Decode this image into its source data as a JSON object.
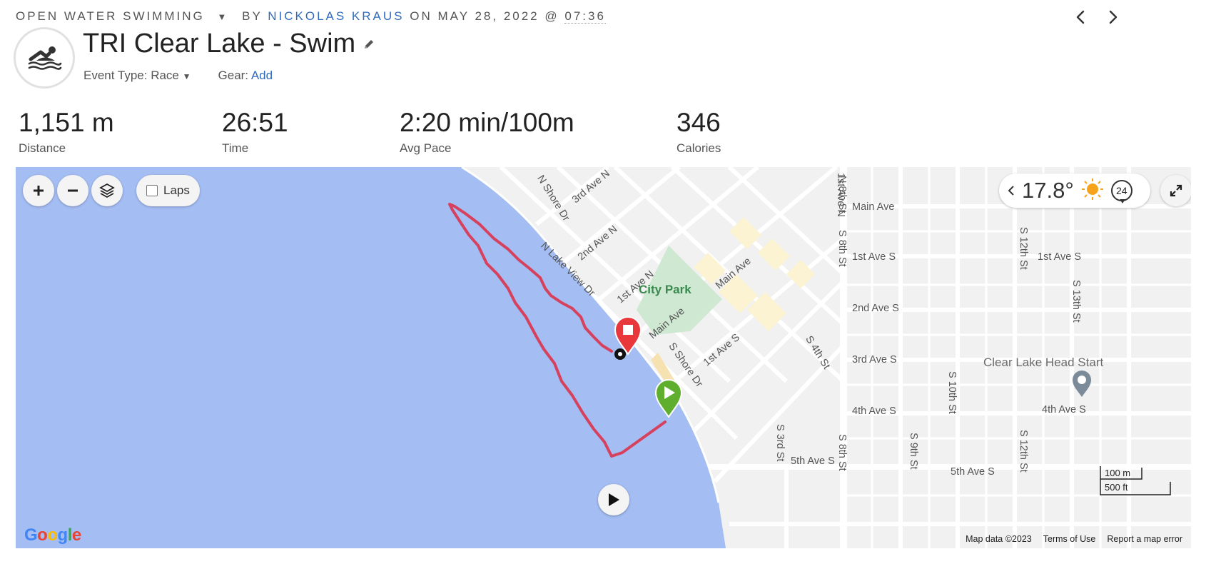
{
  "header": {
    "activity_type": "OPEN WATER SWIMMING",
    "by_text": "BY",
    "author": "NICKOLAS KRAUS",
    "on_text": "ON",
    "date": "MAY 28, 2022",
    "at_text": "@",
    "time": "07:36",
    "title": "TRI Clear Lake - Swim",
    "event_type_label": "Event Type:",
    "event_type_value": "Race",
    "gear_label": "Gear:",
    "gear_action": "Add"
  },
  "icons": {
    "activity": "swim-icon",
    "edit": "pencil-icon",
    "prev": "chevron-left-icon",
    "next": "chevron-right-icon"
  },
  "stats": [
    {
      "value": "1,151 m",
      "label": "Distance"
    },
    {
      "value": "26:51",
      "label": "Time"
    },
    {
      "value": "2:20 min/100m",
      "label": "Avg Pace"
    },
    {
      "value": "346",
      "label": "Calories"
    }
  ],
  "map": {
    "laps_label": "Laps",
    "weather_temp": "17.8°",
    "wind_speed": "24",
    "park": "City Park",
    "poi": "Clear Lake Head Start",
    "streets": {
      "n_shore_dr": "N Shore Dr",
      "third_ave_n": "3rd Ave N",
      "second_ave_n": "2nd Ave N",
      "n_lake_view_dr": "N Lake View Dr",
      "first_ave_n": "1st Ave N",
      "main_ave_1": "Main Ave",
      "main_ave_2": "Main Ave",
      "main_ave_3": "Main Ave",
      "s_shore_dr": "S Shore Dr",
      "first_ave_s_1": "1st Ave S",
      "first_ave_s_2": "1st Ave S",
      "first_ave_s_3": "1st Ave S",
      "second_ave_s": "2nd Ave S",
      "third_ave_s": "3rd Ave S",
      "fourth_ave_s_1": "4th Ave S",
      "fourth_ave_s_2": "4th Ave S",
      "fifth_ave_s_1": "5th Ave S",
      "fifth_ave_s_2": "5th Ave S",
      "s_4th_st": "S 4th St",
      "s_3rd_st": "S 3rd St",
      "n_8th_st": "N 8th St",
      "s_8th_st_1": "S 8th St",
      "s_8th_st_2": "S 8th St",
      "s_9th_st": "S 9th St",
      "s_10th_st": "S 10th St",
      "s_12th_st_1": "S 12th St",
      "s_12th_st_2": "S 12th St",
      "s_13th_st": "S 13th St",
      "first_ave_n_top": "1st Ave N"
    },
    "scale_metric": "100 m",
    "scale_imperial": "500 ft",
    "attribution": {
      "map_data": "Map data ©2023",
      "terms": "Terms of Use",
      "report": "Report a map error"
    },
    "colors": {
      "water": "#a4bdf3",
      "track": "#d6415e",
      "start_marker": "#5fae2e",
      "end_marker": "#e8383b"
    }
  }
}
